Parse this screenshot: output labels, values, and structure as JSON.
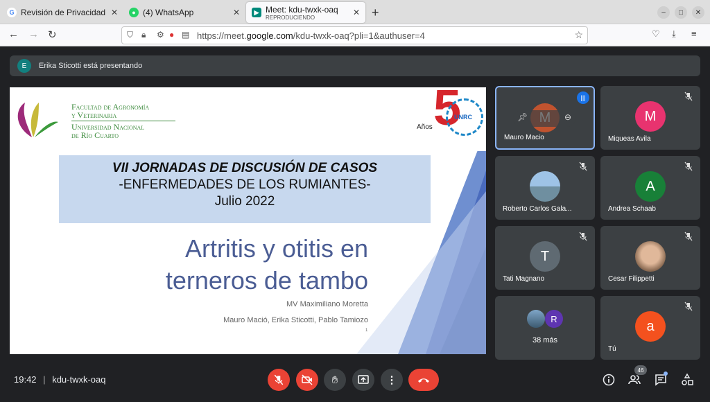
{
  "tabs": [
    {
      "label": "Revisión de Privacidad",
      "fav": "G"
    },
    {
      "label": "(4) WhatsApp",
      "fav": "W"
    },
    {
      "label": "Meet: kdu-twxk-oaq",
      "sub": "REPRODUCIENDO"
    }
  ],
  "url": {
    "pre": "https://meet.",
    "host": "google.com",
    "post": "/kdu-twxk-oaq?pli=1&authuser=4"
  },
  "banner": {
    "initial": "E",
    "text": "Erika Sticotti está presentando"
  },
  "slide": {
    "fac": [
      "Facultad de Agronomía",
      "y Veterinaria",
      "Universidad Nacional",
      "de Río Cuarto"
    ],
    "logo_num": "5",
    "logo_anos": "Años",
    "logo_unrc": "UNRC",
    "line1": "VII JORNADAS DE DISCUSIÓN DE CASOS",
    "line2": "-ENFERMEDADES DE LOS RUMIANTES-",
    "line3": "Julio 2022",
    "title1": "Artritis y otitis en",
    "title2": "terneros de tambo",
    "author1": "MV Maximiliano Moretta",
    "author2": "Mauro Mació, Erika Sticotti, Pablo Tamiozo",
    "page": "1"
  },
  "participants": [
    {
      "name": "Mauro Macio",
      "initial": "M",
      "color": "#c0532f"
    },
    {
      "name": "Miqueas Avila",
      "initial": "M",
      "color": "#e8336f"
    },
    {
      "name": "Roberto Carlos Gala...",
      "initial": "",
      "color": "#7fa6c8"
    },
    {
      "name": "Andrea Schaab",
      "initial": "A",
      "color": "#188038"
    },
    {
      "name": "Tati Magnano",
      "initial": "T",
      "color": "#5f6a72"
    },
    {
      "name": "Cesar Filippetti",
      "initial": "",
      "color": "#d8c8b8"
    },
    {
      "more": "38 más",
      "initial": "R"
    },
    {
      "name": "Tú",
      "initial": "a",
      "color": "#f4511e"
    }
  ],
  "meeting": {
    "time": "19:42",
    "sep": "|",
    "code": "kdu-twxk-oaq"
  },
  "people_count": "46"
}
